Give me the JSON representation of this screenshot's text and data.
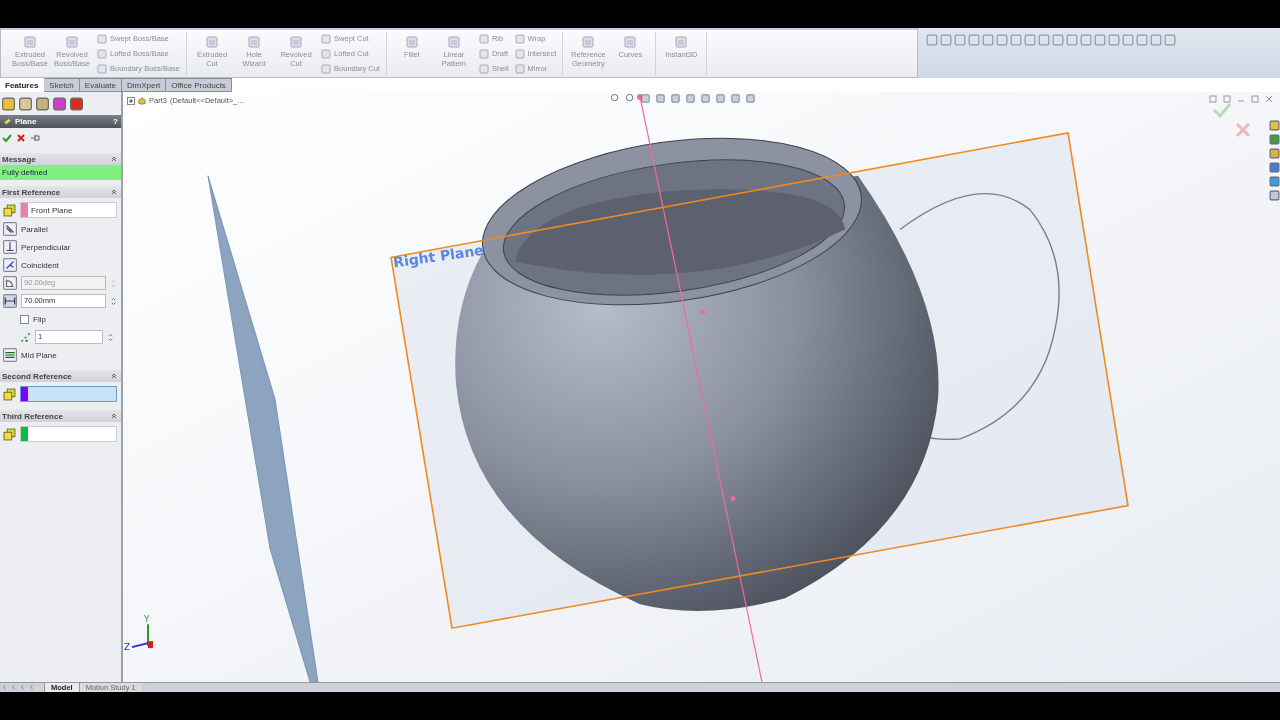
{
  "toolbar": {
    "groups": [
      {
        "items": [
          {
            "kind": "large",
            "label": "Extruded Boss/Base"
          },
          {
            "kind": "large",
            "label": "Revolved Boss/Base"
          },
          {
            "kind": "stack",
            "labels": [
              "Swept Boss/Base",
              "Lofted Boss/Base",
              "Boundary Boss/Base"
            ]
          }
        ]
      },
      {
        "items": [
          {
            "kind": "large",
            "label": "Extruded Cut"
          },
          {
            "kind": "large",
            "label": "Hole Wizard"
          },
          {
            "kind": "large",
            "label": "Revolved Cut"
          },
          {
            "kind": "stack",
            "labels": [
              "Swept Cut",
              "Lofted Cut",
              "Boundary Cut"
            ]
          }
        ]
      },
      {
        "items": [
          {
            "kind": "large",
            "label": "Fillet"
          },
          {
            "kind": "large",
            "label": "Linear Pattern"
          },
          {
            "kind": "stack",
            "labels": [
              "Rib",
              "Draft",
              "Shell"
            ]
          },
          {
            "kind": "stack",
            "labels": [
              "Wrap",
              "Intersect",
              "Mirror"
            ]
          }
        ]
      },
      {
        "items": [
          {
            "kind": "large",
            "label": "Reference Geometry"
          },
          {
            "kind": "large",
            "label": "Curves"
          }
        ]
      },
      {
        "items": [
          {
            "kind": "large",
            "label": "Instant3D"
          }
        ]
      }
    ]
  },
  "command_tabs": [
    {
      "label": "Features",
      "selected": true
    },
    {
      "label": "Sketch",
      "selected": false
    },
    {
      "label": "Evaluate",
      "selected": false
    },
    {
      "label": "DimXpert",
      "selected": false
    },
    {
      "label": "Office Products",
      "selected": false
    }
  ],
  "tree": {
    "part": "Part3",
    "configuration": "(Default<<Default>_..."
  },
  "property_manager": {
    "title": "Plane",
    "help": "?",
    "message": {
      "title": "Message",
      "text": "Fully defined"
    },
    "sections": [
      {
        "title": "First Reference",
        "rows": [
          {
            "kind": "reference",
            "value": "Front Plane",
            "color": "#f07cb0",
            "active": false
          },
          {
            "kind": "option",
            "label": "Parallel"
          },
          {
            "kind": "option",
            "label": "Perpendicular"
          },
          {
            "kind": "option",
            "label": "Coincident"
          },
          {
            "kind": "spin",
            "value": "90.00deg",
            "disabled": true
          },
          {
            "kind": "spin",
            "value": "70.00mm",
            "disabled": false
          },
          {
            "kind": "checkbox",
            "label": "Flip",
            "checked": false
          },
          {
            "kind": "count",
            "value": "1"
          },
          {
            "kind": "option",
            "label": "Mid Plane"
          }
        ]
      },
      {
        "title": "Second Reference",
        "rows": [
          {
            "kind": "reference",
            "color": "#8000ff",
            "active": true
          }
        ]
      },
      {
        "title": "Third Reference",
        "rows": [
          {
            "kind": "reference",
            "color": "#00c040",
            "active": false
          }
        ]
      }
    ]
  },
  "viewport": {
    "plane_label": "Right Plane",
    "triad": {
      "y": "Y",
      "z": "Z"
    }
  },
  "bottom_tabs": [
    {
      "label": "Model",
      "selected": true
    },
    {
      "label": "Motion Study 1",
      "selected": false
    }
  ]
}
